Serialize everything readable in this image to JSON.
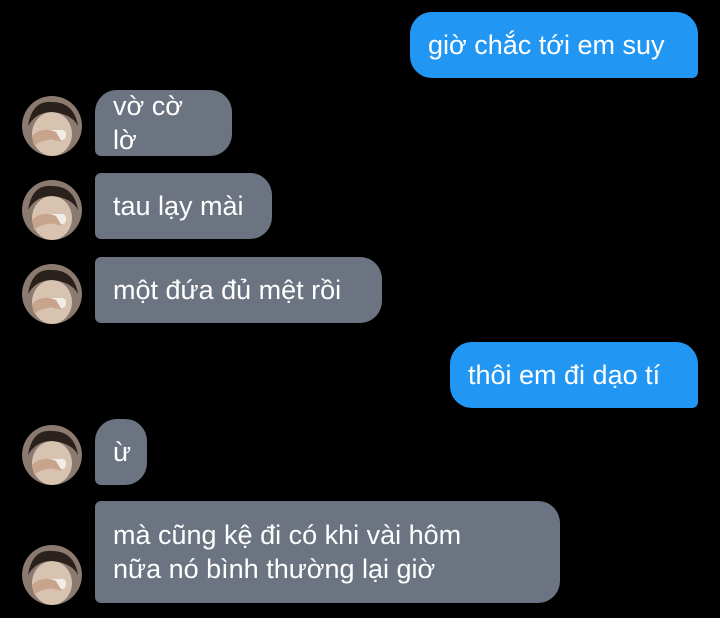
{
  "conversation": {
    "accent_out": "#2196f3",
    "accent_in": "#6b7480",
    "messages": [
      {
        "direction": "outgoing",
        "text": "giờ chắc tới em suy"
      },
      {
        "direction": "incoming",
        "text": "vờ cờ lờ",
        "avatar_icon": "user-avatar-icon"
      },
      {
        "direction": "incoming",
        "text": "tau lạy mài",
        "avatar_icon": "user-avatar-icon"
      },
      {
        "direction": "incoming",
        "text": "một đứa đủ mệt rồi",
        "avatar_icon": "user-avatar-icon"
      },
      {
        "direction": "outgoing",
        "text": "thôi em đi dạo tí"
      },
      {
        "direction": "incoming",
        "text": "ừ",
        "avatar_icon": "user-avatar-icon"
      },
      {
        "direction": "incoming",
        "text": "mà cũng kệ đi có khi vài hôm\nnữa nó bình thường lại giờ",
        "avatar_icon": "user-avatar-icon"
      }
    ]
  }
}
